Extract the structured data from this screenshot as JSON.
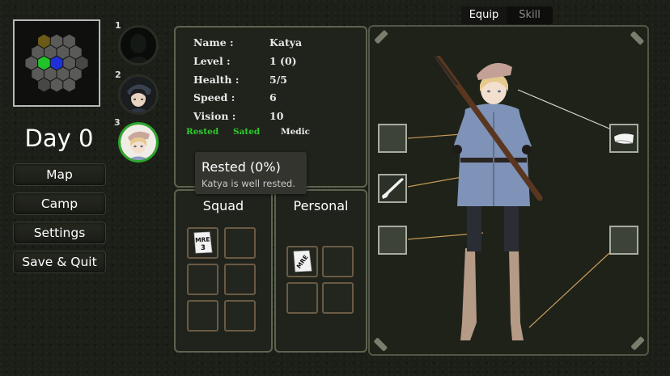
{
  "colors": {
    "accent_green": "#2ecc2e",
    "panel_border": "#5c6451",
    "cell_border": "#6a5a44",
    "lead_line": "#c89a58"
  },
  "minimap": {
    "icon": "hex-minimap"
  },
  "party": [
    {
      "slot": "1",
      "portrait": "silhouette-portrait-icon",
      "selected": false
    },
    {
      "slot": "2",
      "portrait": "soldier-cap-portrait-icon",
      "selected": false
    },
    {
      "slot": "3",
      "portrait": "katya-portrait-icon",
      "selected": true
    }
  ],
  "day_label": "Day 0",
  "menu": [
    {
      "label": "Map"
    },
    {
      "label": "Camp"
    },
    {
      "label": "Settings"
    },
    {
      "label": "Save & Quit"
    }
  ],
  "stats": [
    {
      "label": "Name :",
      "value": "Katya"
    },
    {
      "label": "Level :",
      "value": "1 (0)"
    },
    {
      "label": "Health :",
      "value": "5/5"
    },
    {
      "label": "Speed :",
      "value": "6"
    },
    {
      "label": "Vision :",
      "value": "10"
    }
  ],
  "status_tags": [
    {
      "text": "Rested",
      "color": "#2ecc2e"
    },
    {
      "text": "Sated",
      "color": "#2ecc2e"
    },
    {
      "text": "Medic",
      "color": "#e8e8e8"
    }
  ],
  "tooltip": {
    "title": "Rested (0%)",
    "description": "Katya is well rested."
  },
  "squad": {
    "title": "Squad",
    "items": [
      {
        "icon": "mre-ration-icon",
        "label": "MRE",
        "count": "3"
      }
    ]
  },
  "personal": {
    "title": "Personal",
    "items": [
      {
        "icon": "mre-ration-icon",
        "label": "MRE"
      }
    ]
  },
  "tabs": [
    {
      "label": "Equip",
      "active": true
    },
    {
      "label": "Skill",
      "active": false
    }
  ],
  "equipment": {
    "left_slots": [
      {
        "icon": "empty-slot",
        "filled": false
      },
      {
        "icon": "rifle-icon",
        "filled": true
      },
      {
        "icon": "empty-slot",
        "filled": false
      }
    ],
    "right_slots": [
      {
        "icon": "garrison-cap-icon",
        "filled": true
      },
      {
        "icon": "empty-slot",
        "filled": false
      }
    ]
  }
}
